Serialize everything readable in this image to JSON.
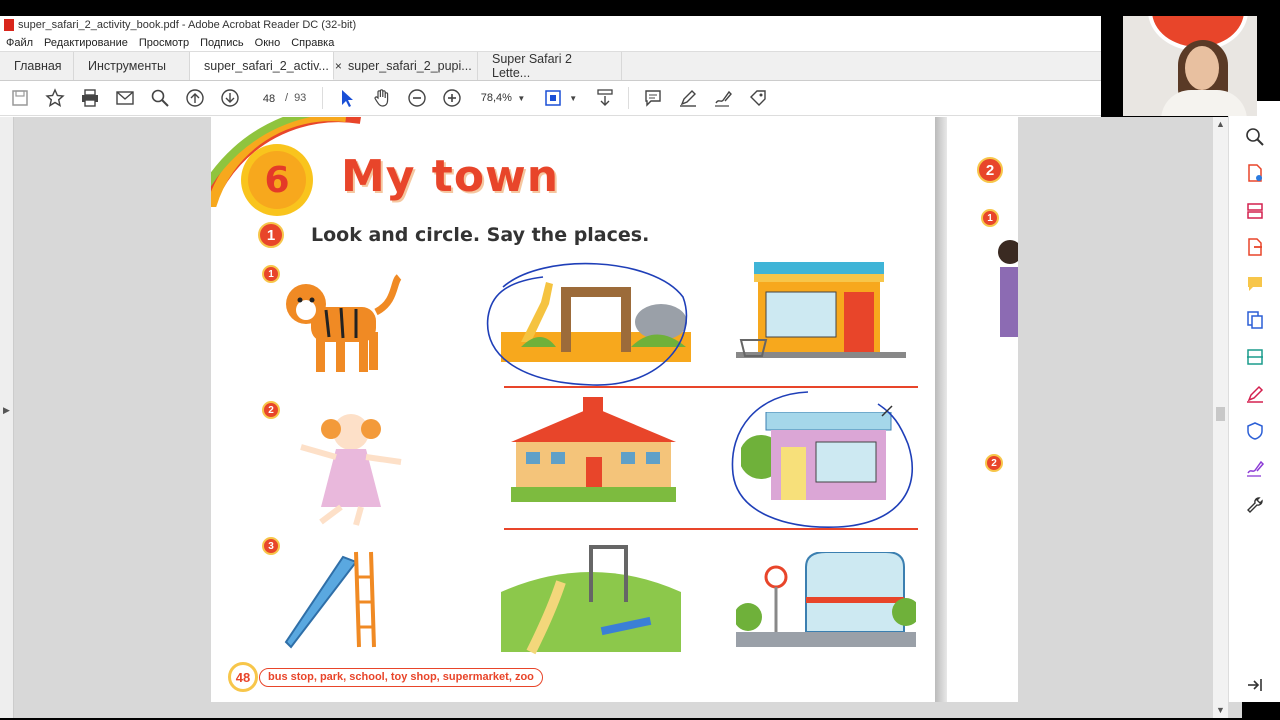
{
  "window": {
    "title": "super_safari_2_activity_book.pdf - Adobe Acrobat Reader DC (32-bit)"
  },
  "menu": [
    "Файл",
    "Редактирование",
    "Просмотр",
    "Подпись",
    "Окно",
    "Справка"
  ],
  "tabs": {
    "home": "Главная",
    "tools": "Инструменты",
    "docs": [
      {
        "label": "super_safari_2_activ...",
        "active": true,
        "close": "×"
      },
      {
        "label": "super_safari_2_pupi...",
        "active": false
      },
      {
        "label": "Super Safari 2 Lette...",
        "active": false
      }
    ]
  },
  "toolbar": {
    "page_current": "48",
    "page_sep": "/",
    "page_total": "93",
    "zoom": "78,4%",
    "icons": [
      "save-icon",
      "star-icon",
      "print-icon",
      "mail-icon",
      "search-icon",
      "page-up-icon",
      "page-down-icon",
      "select-cursor-icon",
      "hand-icon",
      "zoom-out-icon",
      "zoom-in-icon",
      "fit-page-icon",
      "scroll-mode-icon",
      "comment-icon",
      "highlight-pen-icon",
      "sign-icon",
      "more-tools-icon"
    ]
  },
  "page": {
    "unit_number": "6",
    "unit_title": "My town",
    "exercise_number": "1",
    "instruction": "Look and circle. Say the places.",
    "rows": [
      "1",
      "2",
      "3"
    ],
    "page_number": "48",
    "word_box": "bus stop, park, school, toy shop, supermarket, zoo"
  },
  "page2": {
    "badges": [
      "2",
      "1",
      "2"
    ]
  },
  "colors": {
    "accent": "#e8452a",
    "badge_ring": "#f7c64a",
    "annotation": "#1f3fb8"
  },
  "right_panel_icons": [
    "zoom-search-icon",
    "create-pdf-icon",
    "organize-pages-icon",
    "export-pdf-icon",
    "comment-panel-icon",
    "combine-files-icon",
    "scan-icon",
    "fill-sign-icon",
    "protect-icon",
    "request-signature-icon",
    "more-tools-wrench-icon",
    "collapse-panel-icon"
  ]
}
